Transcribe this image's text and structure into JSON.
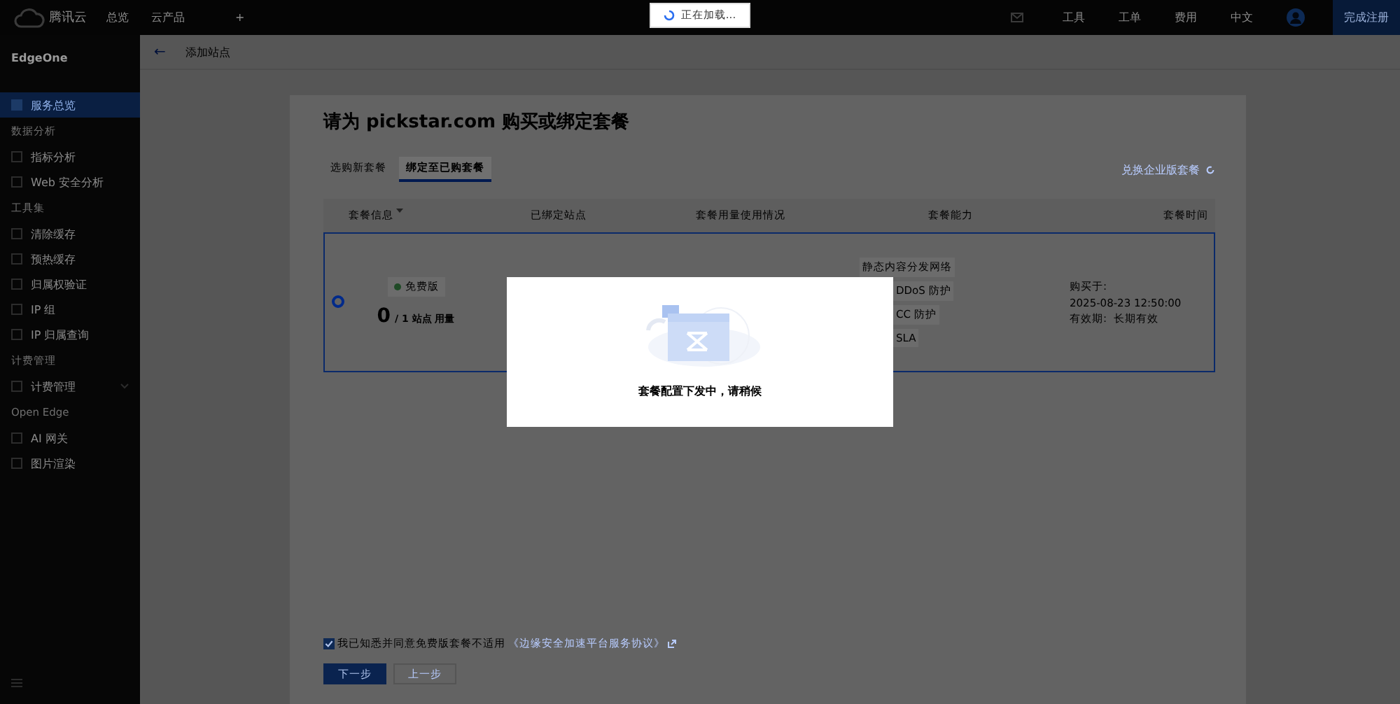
{
  "topbar": {
    "logo": "腾讯云",
    "nav": [
      "总览",
      "云产品"
    ],
    "add": "+",
    "right": [
      "工具",
      "工单",
      "费用",
      "中文"
    ],
    "register": "完成注册"
  },
  "loading": {
    "text": "正在加载..."
  },
  "sidebar": {
    "title": "EdgeOne",
    "items": [
      {
        "kind": "item",
        "label": "服务总览",
        "selected": true
      },
      {
        "kind": "group",
        "label": "数据分析"
      },
      {
        "kind": "item",
        "label": "指标分析",
        "selected": false
      },
      {
        "kind": "item",
        "label": "Web 安全分析",
        "selected": false
      },
      {
        "kind": "group",
        "label": "工具集"
      },
      {
        "kind": "item",
        "label": "清除缓存",
        "selected": false
      },
      {
        "kind": "item",
        "label": "预热缓存",
        "selected": false
      },
      {
        "kind": "item",
        "label": "归属权验证",
        "selected": false
      },
      {
        "kind": "item",
        "label": "IP 组",
        "selected": false
      },
      {
        "kind": "item",
        "label": "IP 归属查询",
        "selected": false
      },
      {
        "kind": "group",
        "label": "计费管理"
      },
      {
        "kind": "item",
        "label": "计费管理",
        "selected": false,
        "expanded": false
      },
      {
        "kind": "group",
        "label": "Open Edge"
      },
      {
        "kind": "item",
        "label": "AI 网关",
        "selected": false
      },
      {
        "kind": "item",
        "label": "图片渲染",
        "selected": false
      }
    ]
  },
  "header": {
    "back": "←",
    "title": "添加站点"
  },
  "page": {
    "title": "请为 pickstar.com 购买或绑定套餐",
    "tabs": [
      {
        "label": "选购新套餐",
        "selected": false
      },
      {
        "label": "绑定至已购套餐",
        "selected": true
      }
    ],
    "redeem_link": "兑换企业版套餐",
    "table": {
      "columns": [
        "套餐信息",
        "已绑定站点",
        "套餐用量使用情况",
        "套餐能力",
        "套餐时间"
      ],
      "rows": [
        {
          "selected": true,
          "tag": "免费版",
          "usage_count": "0",
          "usage_total": "/ 1 站点 用量",
          "capabilities": [
            "静态内容分发网络",
            "DDoS 防护",
            "CC 防护",
            "SLA"
          ],
          "time": [
            "购买于:",
            "2025-08-23 12:50:00",
            "有效期:  长期有效"
          ]
        }
      ]
    },
    "agreement": {
      "checked": true,
      "text": "我已知悉并同意免费版套餐不适用",
      "link": "《边缘安全加速平台服务协议》"
    },
    "buttons": [
      {
        "label": "下一步",
        "kind": "primary"
      },
      {
        "label": "上一步",
        "kind": "secondary"
      }
    ]
  },
  "modal": {
    "message": "套餐配置下发中，请稍候"
  }
}
